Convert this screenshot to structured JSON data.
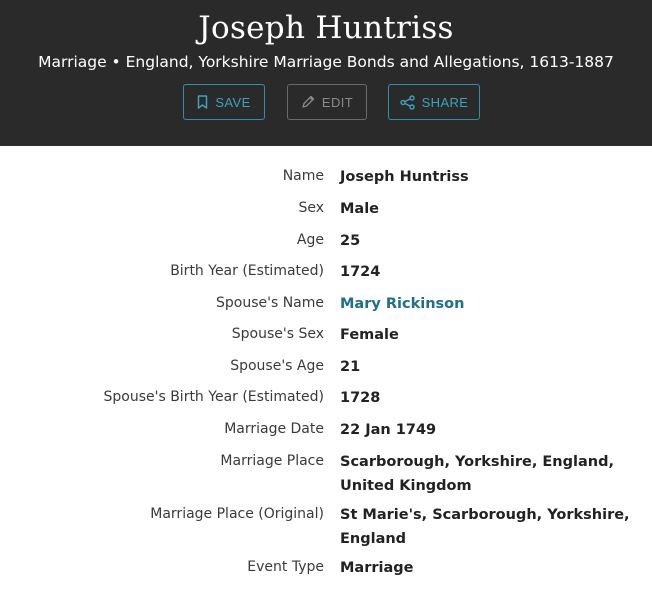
{
  "header": {
    "title": "Joseph Huntriss",
    "subtitle": "Marriage • England, Yorkshire Marriage Bonds and Allegations, 1613-1887",
    "buttons": {
      "save": {
        "label": "SAVE",
        "icon": "bookmark-icon"
      },
      "edit": {
        "label": "EDIT",
        "icon": "pencil-icon"
      },
      "share": {
        "label": "SHARE",
        "icon": "share-icon"
      }
    }
  },
  "details": [
    {
      "label": "Name",
      "value": "Joseph Huntriss"
    },
    {
      "label": "Sex",
      "value": "Male"
    },
    {
      "label": "Age",
      "value": "25"
    },
    {
      "label": "Birth Year (Estimated)",
      "value": "1724"
    },
    {
      "label": "Spouse's Name",
      "value": "Mary Rickinson",
      "link": true
    },
    {
      "label": "Spouse's Sex",
      "value": "Female"
    },
    {
      "label": "Spouse's Age",
      "value": "21"
    },
    {
      "label": "Spouse's Birth Year (Estimated)",
      "value": "1728"
    },
    {
      "label": "Marriage Date",
      "value": "22 Jan 1749"
    },
    {
      "label": "Marriage Place",
      "value": "Scarborough, Yorkshire, England, United Kingdom"
    },
    {
      "label": "Marriage Place (Original)",
      "value": "St Marie's, Scarborough, Yorkshire, England"
    },
    {
      "label": "Event Type",
      "value": "Marriage"
    }
  ],
  "colors": {
    "header_bg": "#2a2a2a",
    "accent": "#3aa3bf",
    "link": "#1f6f8b"
  }
}
